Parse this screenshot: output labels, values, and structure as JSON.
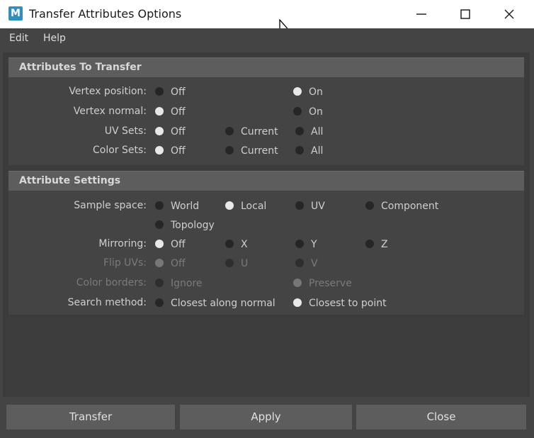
{
  "window": {
    "title": "Transfer Attributes Options",
    "icon_letter": "M"
  },
  "menu": [
    "Edit",
    "Help"
  ],
  "sections": {
    "attributes_to_transfer": {
      "title": "Attributes To Transfer",
      "rows": [
        {
          "label": "Vertex position:",
          "options": [
            "Off",
            "On"
          ],
          "selected": "On"
        },
        {
          "label": "Vertex normal:",
          "options": [
            "Off",
            "On"
          ],
          "selected": "Off"
        },
        {
          "label": "UV Sets:",
          "options": [
            "Off",
            "Current",
            "All"
          ],
          "selected": "Off"
        },
        {
          "label": "Color Sets:",
          "options": [
            "Off",
            "Current",
            "All"
          ],
          "selected": "Off"
        }
      ]
    },
    "attribute_settings": {
      "title": "Attribute Settings",
      "rows": [
        {
          "label": "Sample space:",
          "options": [
            "World",
            "Local",
            "UV",
            "Component",
            "Topology"
          ],
          "selected": "Local"
        },
        {
          "label": "Mirroring:",
          "options": [
            "Off",
            "X",
            "Y",
            "Z"
          ],
          "selected": "Off"
        },
        {
          "label": "Flip UVs:",
          "options": [
            "Off",
            "U",
            "V"
          ],
          "selected": "Off",
          "disabled": true
        },
        {
          "label": "Color borders:",
          "options": [
            "Ignore",
            "Preserve"
          ],
          "selected": "Preserve",
          "disabled": true
        },
        {
          "label": "Search method:",
          "options": [
            "Closest along normal",
            "Closest to point"
          ],
          "selected": "Closest to point"
        }
      ]
    }
  },
  "buttons": {
    "transfer": "Transfer",
    "apply": "Apply",
    "close": "Close"
  },
  "colors": {
    "background": "#444444",
    "section_header": "#5d5d5d",
    "button": "#5d5d5d"
  }
}
